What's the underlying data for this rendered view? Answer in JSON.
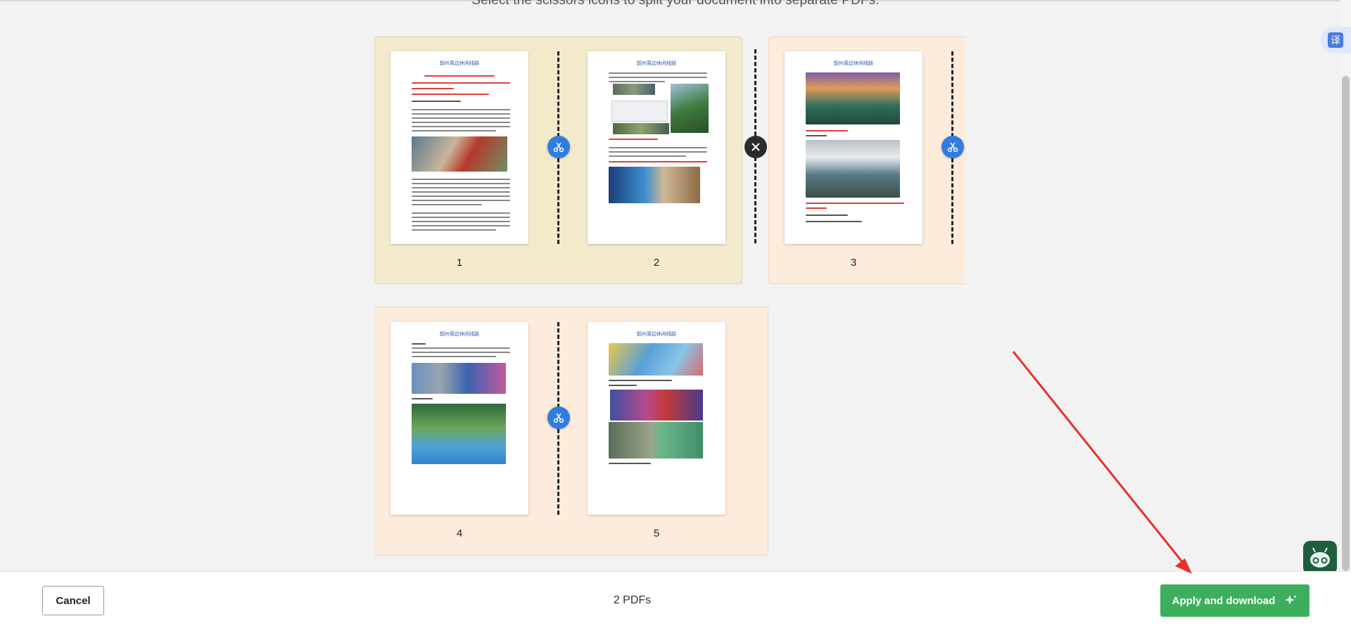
{
  "instruction": "Select the scissors icons to split your document into separate PDFs.",
  "pages": [
    {
      "number": "1",
      "title": "韶州周边休闲线路"
    },
    {
      "number": "2",
      "title": "韶州周边休闲线路"
    },
    {
      "number": "3",
      "title": "韶州周边休闲线路"
    },
    {
      "number": "4",
      "title": "韶州周边休闲线路"
    },
    {
      "number": "5",
      "title": "韶州周边休闲线路"
    }
  ],
  "footer": {
    "cancel_label": "Cancel",
    "pdf_count": "2 PDFs",
    "apply_label": "Apply and download"
  },
  "translate_glyph": "译",
  "colors": {
    "group_1": "#f2eacb",
    "group_2": "#fdebdc",
    "scissor_button": "#2f7de1",
    "apply_button": "#3daf5c",
    "annotation_arrow": "#e8302a"
  },
  "icons": [
    "scissors-icon",
    "close-icon",
    "sparkle-icon",
    "translate-icon",
    "assistant-icon"
  ]
}
